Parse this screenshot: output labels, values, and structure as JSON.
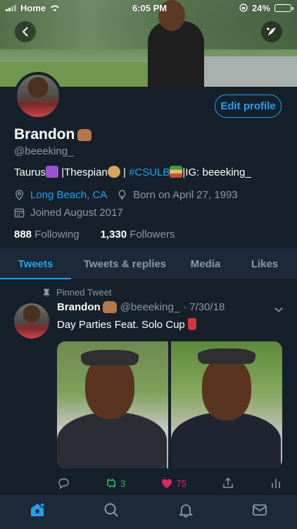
{
  "status_bar": {
    "carrier": "Home",
    "time": "6:05 PM",
    "battery": "24%",
    "battery_level": 0.24
  },
  "profile": {
    "name": "Brandon",
    "handle": "@beeeking_",
    "edit_label": "Edit profile",
    "bio": {
      "part1": "Taurus",
      "part2": " |Thespian",
      "part3": " | ",
      "hashtag": "#CSULB",
      "part4": "|IG: beeeking_"
    },
    "location": "Long Beach, CA",
    "birthday": "Born on April 27, 1993",
    "joined": "Joined August 2017",
    "following_count": "888",
    "following_label": "Following",
    "followers_count": "1,330",
    "followers_label": "Followers"
  },
  "tabs": [
    {
      "label": "Tweets"
    },
    {
      "label": "Tweets & replies"
    },
    {
      "label": "Media"
    },
    {
      "label": "Likes"
    }
  ],
  "tweet": {
    "pinned_label": "Pinned Tweet",
    "author": "Brandon",
    "handle": "@beeeking_",
    "date": "· 7/30/18",
    "text": "Day Parties Feat. Solo Cup",
    "retweets": "3",
    "likes": "75"
  },
  "colors": {
    "accent": "#1da1f2",
    "background": "#15202b",
    "muted": "#8899a6",
    "retweet": "#17bf63",
    "like": "#e0245e"
  }
}
